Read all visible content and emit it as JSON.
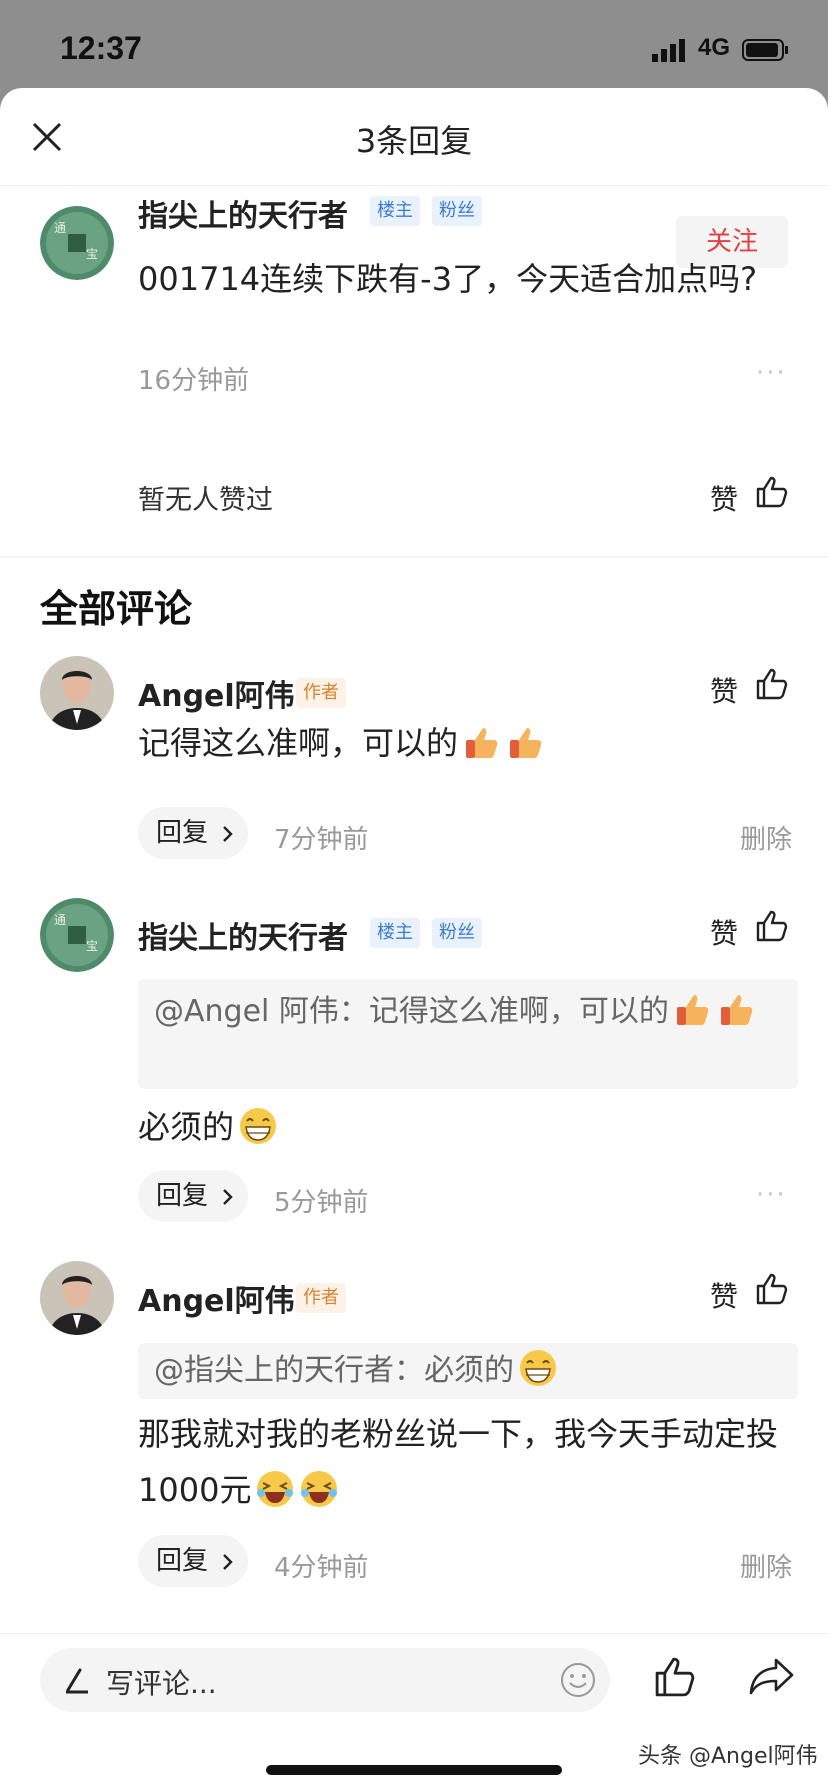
{
  "status_bar": {
    "time": "12:37",
    "network": "4G"
  },
  "header": {
    "title": "3条回复"
  },
  "main_comment": {
    "author": "指尖上的天行者",
    "tags": [
      "楼主",
      "粉丝"
    ],
    "follow_label": "关注",
    "text": "001714连续下跌有-3了，今天适合加点吗?",
    "time": "16分钟前",
    "likes_text": "暂无人赞过",
    "like_label": "赞"
  },
  "section_title": "全部评论",
  "replies": [
    {
      "author": "Angel阿伟",
      "tag": "作者",
      "text": "记得这么准啊，可以的",
      "emojis": [
        "thumbs-up",
        "thumbs-up"
      ],
      "time": "7分钟前",
      "reply_label": "回复",
      "like_label": "赞",
      "action": "删除"
    },
    {
      "author": "指尖上的天行者",
      "tags": [
        "楼主",
        "粉丝"
      ],
      "quote": "@Angel 阿伟：记得这么准啊，可以的",
      "text": "必须的",
      "emojis": [
        "grin"
      ],
      "time": "5分钟前",
      "reply_label": "回复",
      "like_label": "赞"
    },
    {
      "author": "Angel阿伟",
      "tag": "作者",
      "quote": "@指尖上的天行者：必须的",
      "text": "那我就对我的老粉丝说一下，我今天手动定投1000元",
      "emojis": [
        "laugh",
        "laugh"
      ],
      "time": "4分钟前",
      "reply_label": "回复",
      "like_label": "赞",
      "action": "删除"
    }
  ],
  "bottom_bar": {
    "placeholder": "写评论..."
  },
  "watermark": "头条 @Angel阿伟",
  "colors": {
    "follow_red": "#e04242",
    "tag_blue": "#3d7bd0",
    "tag_orange": "#d9822b"
  }
}
